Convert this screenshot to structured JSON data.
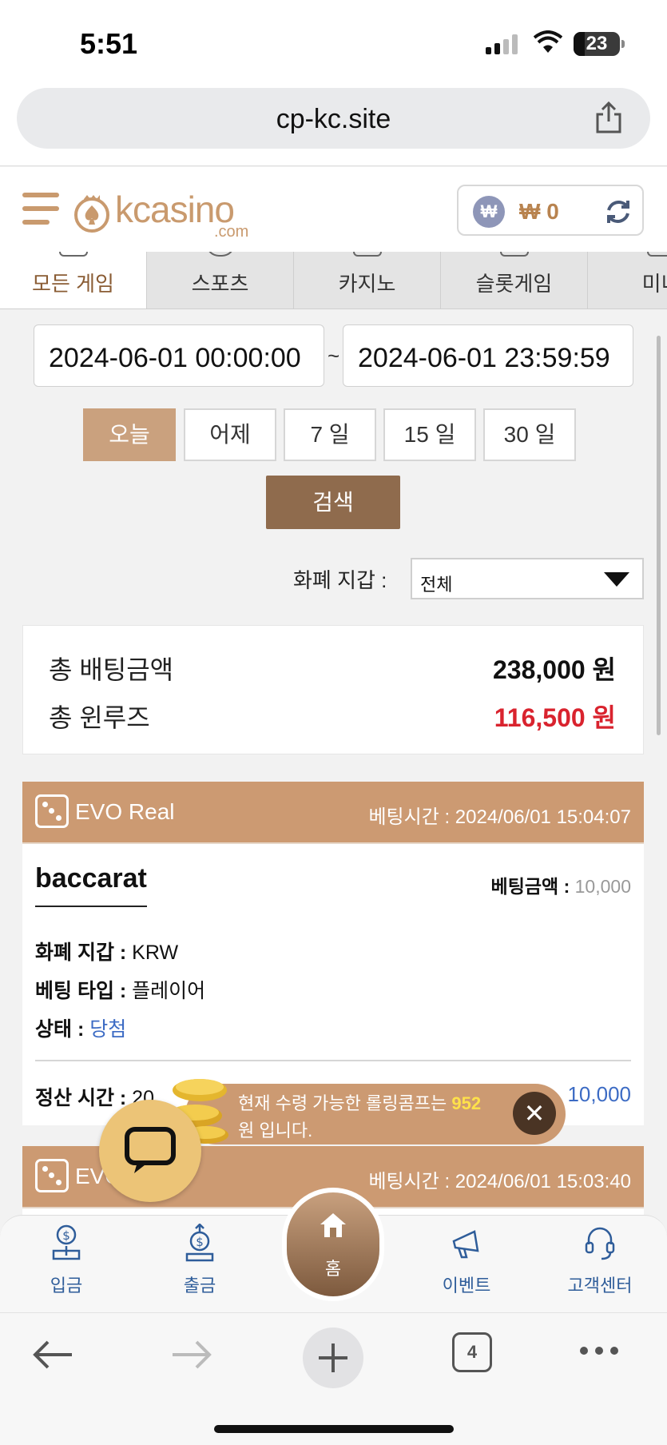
{
  "status": {
    "time": "5:51",
    "battery": "23"
  },
  "browser": {
    "url": "cp-kc.site",
    "tab_count": "4"
  },
  "header": {
    "logo_word": "kcasino",
    "logo_domain": ".com",
    "currency_symbol": "₩",
    "balance": "₩ 0"
  },
  "tabs": [
    {
      "label": "모든 게임",
      "active": true
    },
    {
      "label": "스포츠"
    },
    {
      "label": "카지노"
    },
    {
      "label": "슬롯게임"
    },
    {
      "label": "미니"
    }
  ],
  "filter": {
    "date_from": "2024-06-01 00:00:00",
    "date_to": "2024-06-01 23:59:59",
    "separator": "~",
    "quick": [
      "오늘",
      "어제",
      "7 일",
      "15 일",
      "30 일"
    ],
    "search_label": "검색",
    "currency_label": "화폐 지갑 :",
    "currency_value": "전체"
  },
  "summary": {
    "bet_label": "총 배팅금액",
    "bet_value": "238,000 원",
    "winloss_label": "총 윈루즈",
    "winloss_value": "116,500 원"
  },
  "bets": [
    {
      "provider": "EVO Real",
      "bet_time_label": "베팅시간 :",
      "bet_time": "2024/06/01 15:04:07",
      "game": "baccarat",
      "amount_label": "베팅금액 :",
      "amount": "10,000",
      "currency_label": "화폐 지갑 :",
      "currency": "KRW",
      "type_label": "베팅 타입 :",
      "type": "플레이어",
      "status_label": "상태 :",
      "status": "당첨",
      "settle_label": "정산 시간 :",
      "settle_partial": "20",
      "payout_partial": "10,000"
    },
    {
      "provider": "EVO",
      "bet_time_label": "베팅시간 :",
      "bet_time": "2024/06/01 15:03:40"
    }
  ],
  "toast": {
    "line1_prefix": "현재 수령 가능한 롤링콤프는",
    "amount": "952",
    "line2": "원 입니다.",
    "close": "✕"
  },
  "bottom_nav": {
    "deposit": "입금",
    "withdraw": "출금",
    "home": "홈",
    "event": "이벤트",
    "support": "고객센터"
  },
  "colors": {
    "accent": "#cc9a72",
    "dark_accent": "#8f6b4d",
    "red": "#d9232e",
    "blue": "#3c6bc4"
  }
}
